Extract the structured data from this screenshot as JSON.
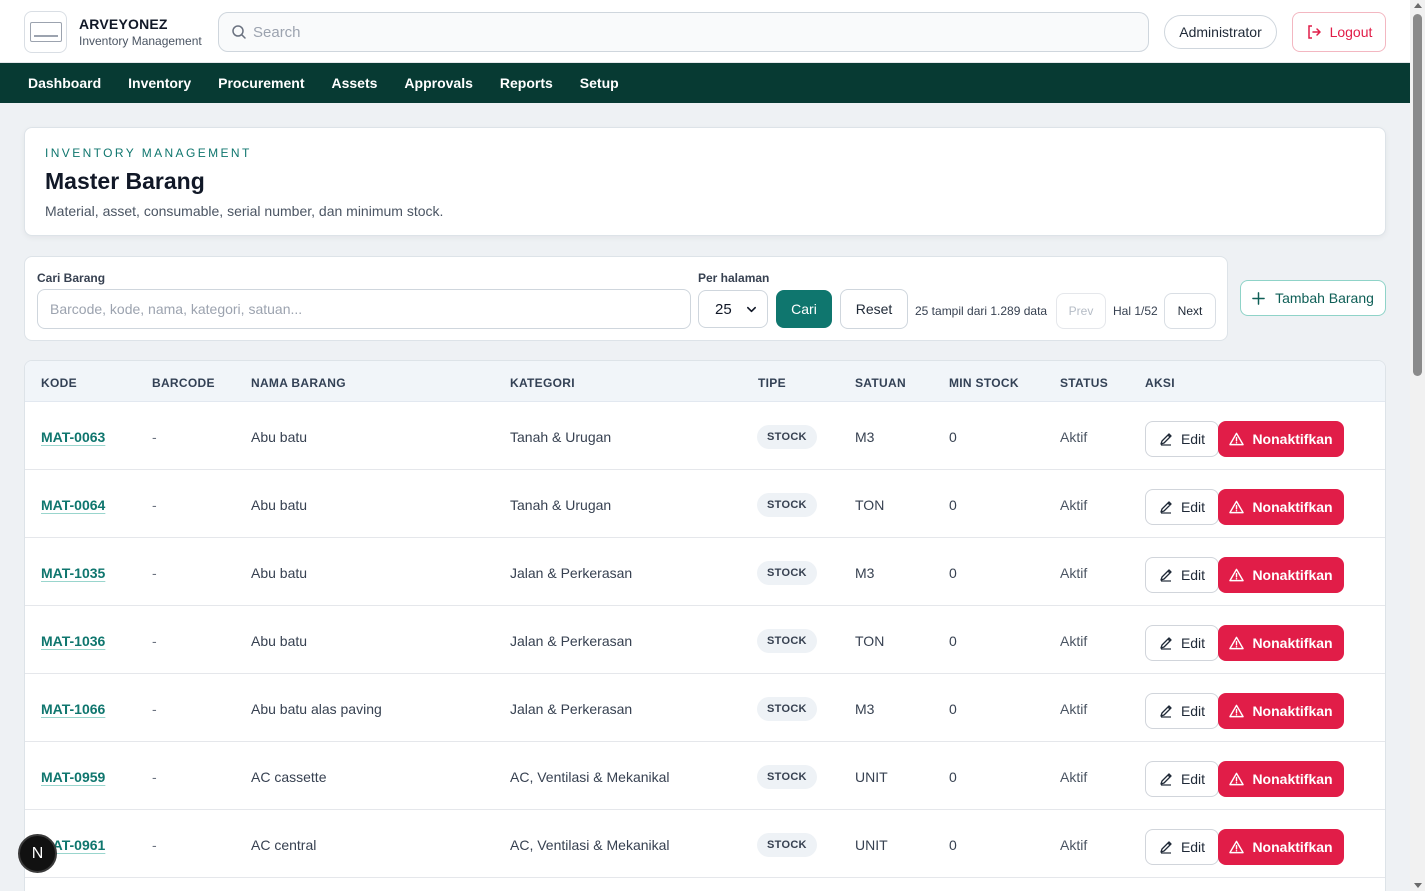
{
  "brand": {
    "title": "ARVEYONEZ",
    "subtitle": "Inventory Management"
  },
  "search": {
    "placeholder": "Search"
  },
  "user": {
    "role": "Administrator"
  },
  "logout_label": "Logout",
  "nav": [
    "Dashboard",
    "Inventory",
    "Procurement",
    "Assets",
    "Approvals",
    "Reports",
    "Setup"
  ],
  "header": {
    "eyebrow": "INVENTORY MANAGEMENT",
    "title": "Master Barang",
    "description": "Material, asset, consumable, serial number, dan minimum stock."
  },
  "filter": {
    "search_label": "Cari Barang",
    "search_placeholder": "Barcode, kode, nama, kategori, satuan...",
    "per_page_label": "Per halaman",
    "per_page_value": "25",
    "search_button": "Cari",
    "reset_button": "Reset",
    "count_text": "25 tampil dari 1.289 data",
    "prev_button": "Prev",
    "page_indicator": "Hal 1/52",
    "next_button": "Next"
  },
  "add_button": "Tambah Barang",
  "table": {
    "columns": [
      "KODE",
      "BARCODE",
      "NAMA BARANG",
      "KATEGORI",
      "TIPE",
      "SATUAN",
      "MIN STOCK",
      "STATUS",
      "AKSI"
    ],
    "rows": [
      {
        "kode": "MAT-0063",
        "barcode": "-",
        "nama": "Abu batu",
        "kategori": "Tanah & Urugan",
        "tipe": "STOCK",
        "satuan": "M3",
        "min_stock": "0",
        "status": "Aktif"
      },
      {
        "kode": "MAT-0064",
        "barcode": "-",
        "nama": "Abu batu",
        "kategori": "Tanah & Urugan",
        "tipe": "STOCK",
        "satuan": "TON",
        "min_stock": "0",
        "status": "Aktif"
      },
      {
        "kode": "MAT-1035",
        "barcode": "-",
        "nama": "Abu batu",
        "kategori": "Jalan & Perkerasan",
        "tipe": "STOCK",
        "satuan": "M3",
        "min_stock": "0",
        "status": "Aktif"
      },
      {
        "kode": "MAT-1036",
        "barcode": "-",
        "nama": "Abu batu",
        "kategori": "Jalan & Perkerasan",
        "tipe": "STOCK",
        "satuan": "TON",
        "min_stock": "0",
        "status": "Aktif"
      },
      {
        "kode": "MAT-1066",
        "barcode": "-",
        "nama": "Abu batu alas paving",
        "kategori": "Jalan & Perkerasan",
        "tipe": "STOCK",
        "satuan": "M3",
        "min_stock": "0",
        "status": "Aktif"
      },
      {
        "kode": "MAT-0959",
        "barcode": "-",
        "nama": "AC cassette",
        "kategori": "AC, Ventilasi & Mekanikal",
        "tipe": "STOCK",
        "satuan": "UNIT",
        "min_stock": "0",
        "status": "Aktif"
      },
      {
        "kode": "MAT-0961",
        "barcode": "-",
        "nama": "AC central",
        "kategori": "AC, Ventilasi & Mekanikal",
        "tipe": "STOCK",
        "satuan": "UNIT",
        "min_stock": "0",
        "status": "Aktif"
      }
    ],
    "edit_label": "Edit",
    "deactivate_label": "Nonaktifkan"
  },
  "fab_label": "N",
  "colors": {
    "primary": "#0f766e",
    "nav_bg": "#073a33",
    "danger": "#e11d48"
  }
}
